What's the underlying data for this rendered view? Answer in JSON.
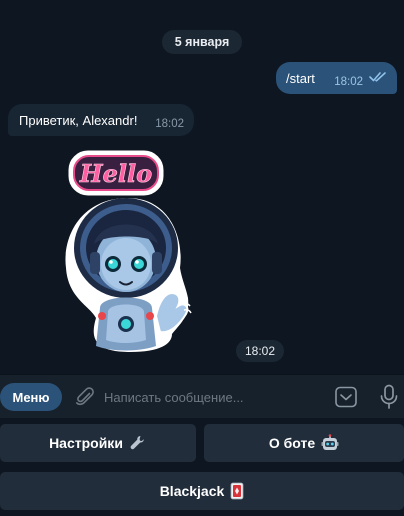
{
  "chat": {
    "date_pill": "5 января",
    "outgoing": {
      "text": "/start",
      "time": "18:02",
      "status": "read-double-check-icon"
    },
    "incoming": {
      "text": "Приветик, Alexandr!",
      "time": "18:02"
    },
    "sticker": {
      "icon": "hello-robot-girl-sticker",
      "sign_text": "Hello",
      "time": "18:02"
    }
  },
  "composer": {
    "menu_label": "Меню",
    "attach_icon": "paperclip-icon",
    "placeholder": "Написать сообщение...",
    "sticker_icon": "sticker-panel-icon",
    "mic_icon": "microphone-icon"
  },
  "keyboard": {
    "settings_label": "Настройки",
    "settings_icon": "wrench-icon",
    "about_label": "О боте",
    "about_icon": "robot-face-icon",
    "blackjack_label": "Blackjack",
    "blackjack_icon": "playing-card-icon"
  },
  "colors": {
    "background": "#0e1621",
    "outgoing_bubble": "#2b5278",
    "incoming_bubble": "#182533",
    "keyboard_button": "#212d3b",
    "accent": "#2b5278"
  }
}
